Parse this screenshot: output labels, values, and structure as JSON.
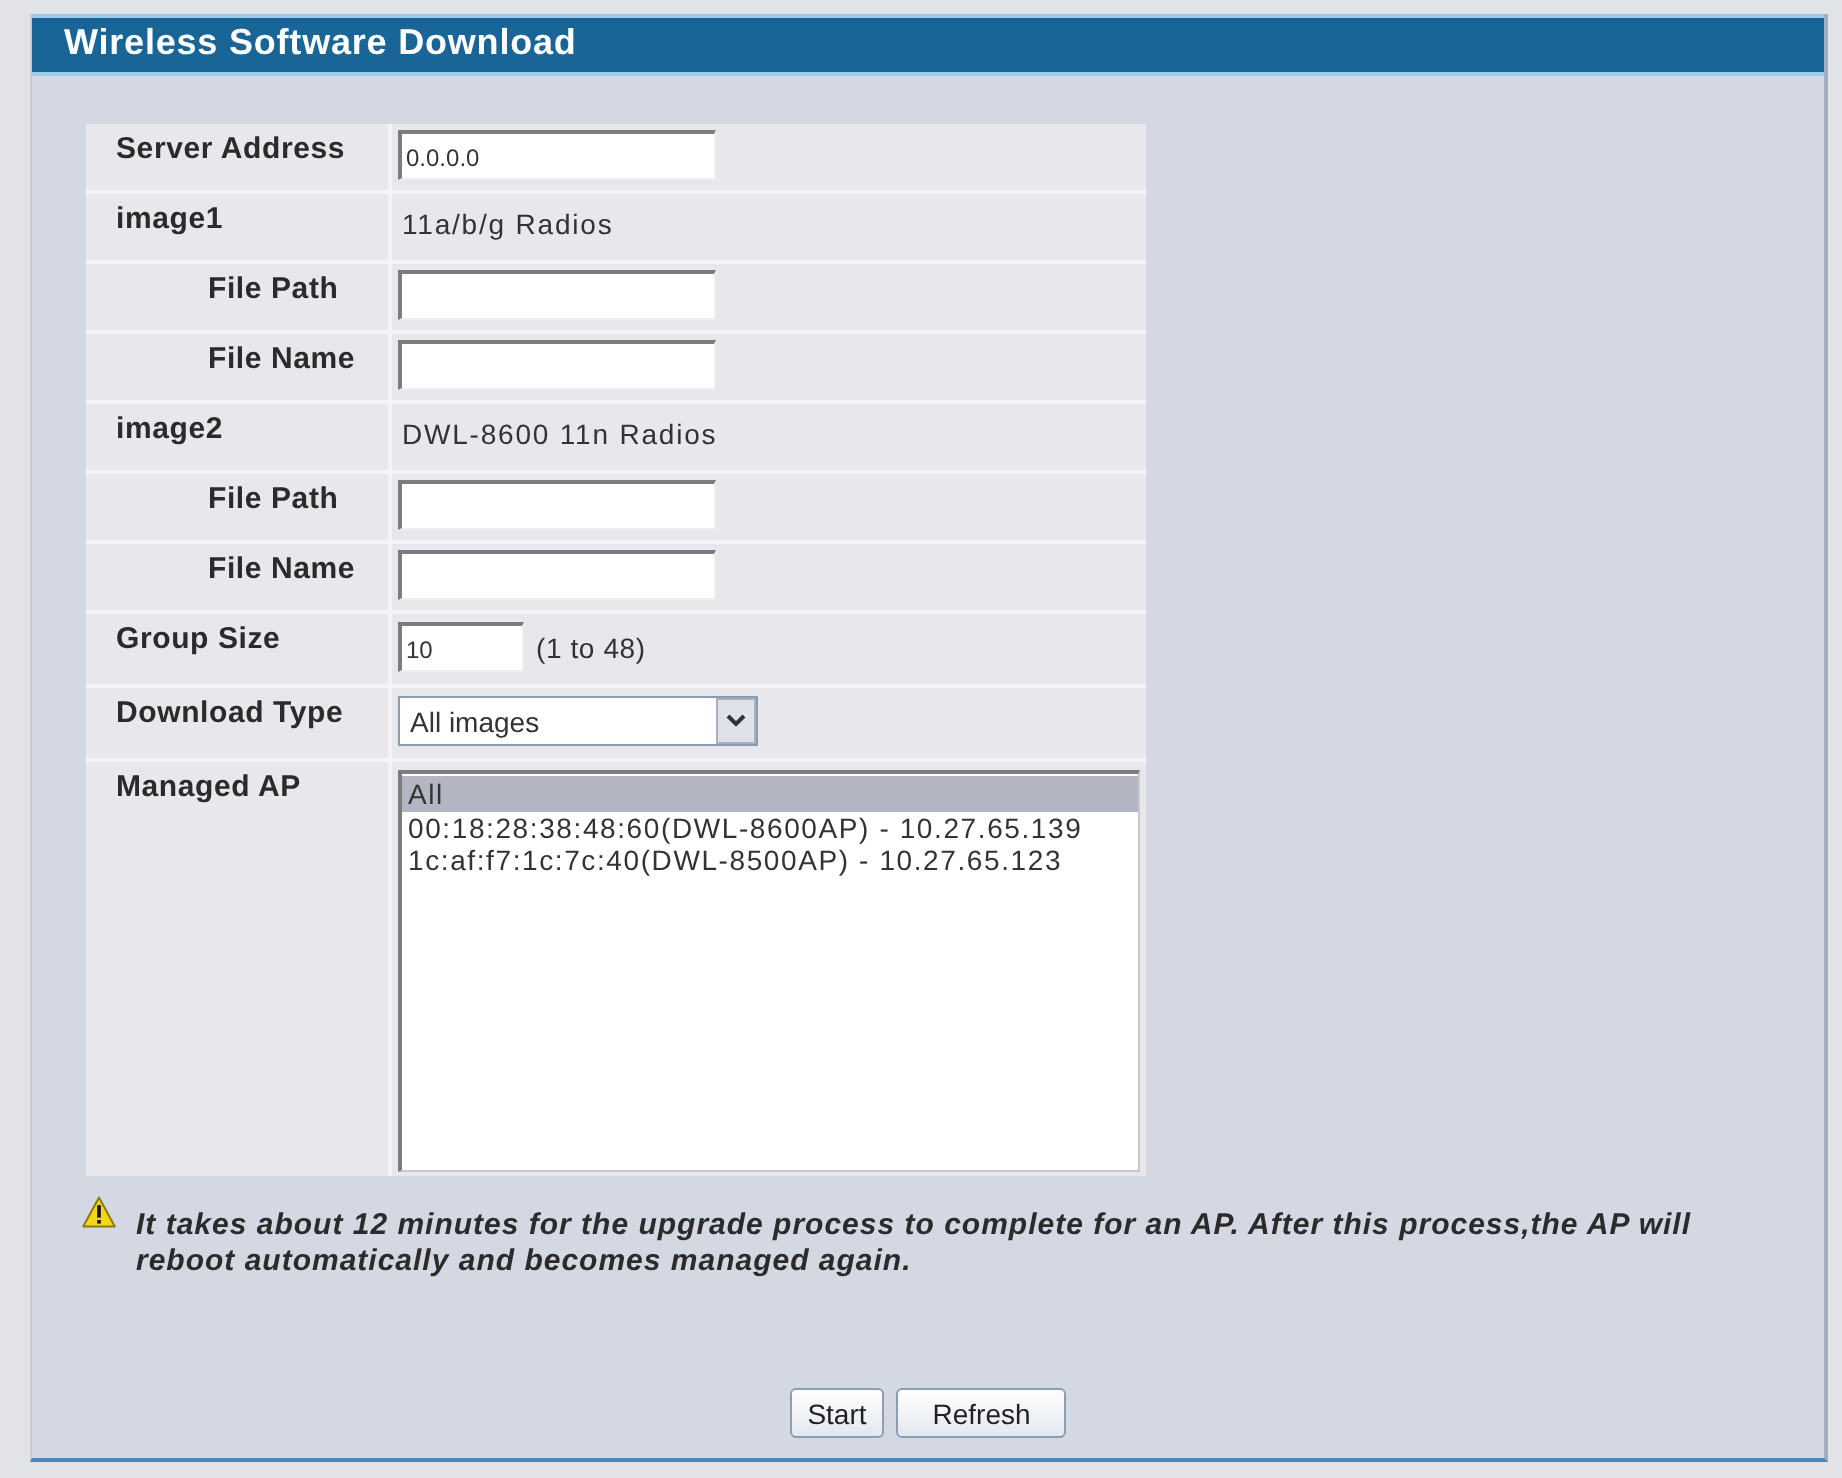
{
  "panel": {
    "title": "Wireless Software Download"
  },
  "form": {
    "rows": [
      {
        "kind": "input",
        "label": "Server Address",
        "value": "0.0.0.0"
      },
      {
        "kind": "text",
        "label": "image1",
        "value": "11a/b/g Radios",
        "children": [
          {
            "kind": "input",
            "label": "File Path"
          },
          {
            "kind": "input",
            "label": "File Name"
          }
        ]
      },
      {
        "kind": "text",
        "label": "image2",
        "value": "DWL-8600 11n Radios",
        "children": [
          {
            "kind": "input",
            "label": "File Path"
          },
          {
            "kind": "input",
            "label": "File Name"
          }
        ]
      },
      {
        "kind": "number",
        "label": "Group Size",
        "value": "10",
        "hint": "(1 to 48)"
      },
      {
        "kind": "select",
        "label": "Download Type",
        "value": "All images"
      },
      {
        "kind": "listbox",
        "label": "Managed AP",
        "options": [
          {
            "label": "All",
            "selected": true
          },
          {
            "label": "00:18:28:38:48:60(DWL-8600AP) - 10.27.65.139",
            "selected": false
          },
          {
            "label": "1c:af:f7:1c:7c:40(DWL-8500AP) - 10.27.65.123",
            "selected": false
          }
        ]
      }
    ]
  },
  "note": {
    "text": "It takes about 12 minutes for the upgrade process to complete for an AP. After this process,the AP will reboot automatically and becomes managed again."
  },
  "buttons": [
    "Start",
    "Refresh"
  ]
}
